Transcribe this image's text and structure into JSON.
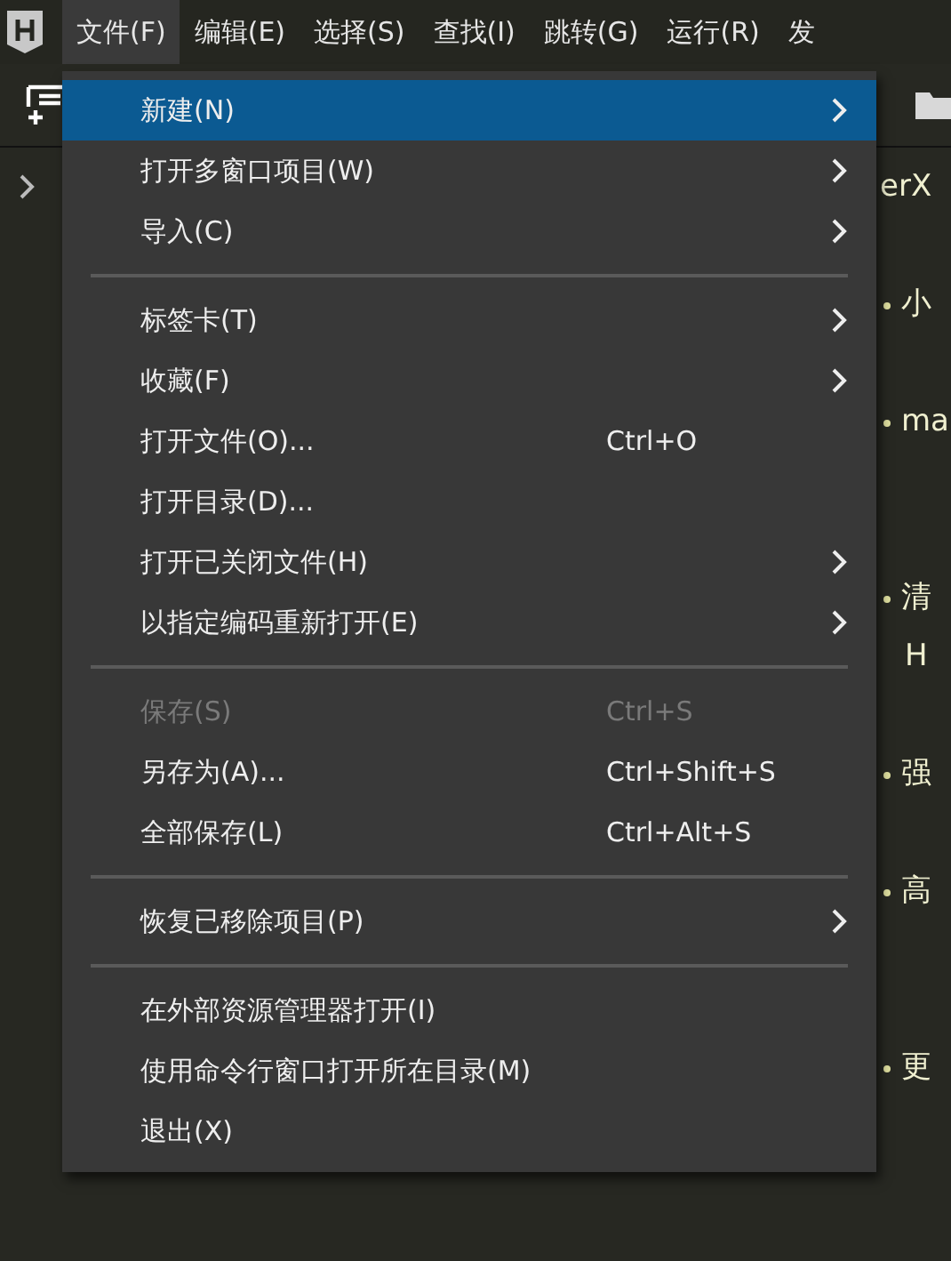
{
  "menubar": [
    {
      "label": "文件(F)",
      "selected": true
    },
    {
      "label": "编辑(E)",
      "selected": false
    },
    {
      "label": "选择(S)",
      "selected": false
    },
    {
      "label": "查找(I)",
      "selected": false
    },
    {
      "label": "跳转(G)",
      "selected": false
    },
    {
      "label": "运行(R)",
      "selected": false
    },
    {
      "label": "发",
      "selected": false
    }
  ],
  "editor": {
    "lines": [
      {
        "kind": "heading",
        "text": "erX"
      },
      {
        "kind": "blank"
      },
      {
        "kind": "bullet",
        "text": "小"
      },
      {
        "kind": "blank"
      },
      {
        "kind": "bullet",
        "text": "ma"
      },
      {
        "kind": "blank"
      },
      {
        "kind": "blank"
      },
      {
        "kind": "bullet",
        "text": "清"
      },
      {
        "kind": "continuation",
        "text": "H"
      },
      {
        "kind": "blank"
      },
      {
        "kind": "bullet",
        "text": "强"
      },
      {
        "kind": "blank"
      },
      {
        "kind": "bullet",
        "text": "高"
      },
      {
        "kind": "blank"
      },
      {
        "kind": "blank"
      },
      {
        "kind": "bullet",
        "text": "更"
      }
    ]
  },
  "menu": {
    "items": [
      {
        "kind": "item",
        "label": "新建(N)",
        "submenu": true,
        "disabled": false,
        "selected": true
      },
      {
        "kind": "item",
        "label": "打开多窗口项目(W)",
        "submenu": true,
        "disabled": false,
        "selected": false
      },
      {
        "kind": "item",
        "label": "导入(C)",
        "submenu": true,
        "disabled": false,
        "selected": false
      },
      {
        "kind": "separator"
      },
      {
        "kind": "item",
        "label": "标签卡(T)",
        "submenu": true,
        "disabled": false,
        "selected": false
      },
      {
        "kind": "item",
        "label": "收藏(F)",
        "submenu": true,
        "disabled": false,
        "selected": false
      },
      {
        "kind": "item",
        "label": "打开文件(O)...",
        "shortcut": "Ctrl+O",
        "submenu": false,
        "disabled": false,
        "selected": false
      },
      {
        "kind": "item",
        "label": "打开目录(D)...",
        "submenu": false,
        "disabled": false,
        "selected": false
      },
      {
        "kind": "item",
        "label": "打开已关闭文件(H)",
        "submenu": true,
        "disabled": false,
        "selected": false
      },
      {
        "kind": "item",
        "label": "以指定编码重新打开(E)",
        "submenu": true,
        "disabled": false,
        "selected": false
      },
      {
        "kind": "separator"
      },
      {
        "kind": "item",
        "label": "保存(S)",
        "shortcut": "Ctrl+S",
        "submenu": false,
        "disabled": true,
        "selected": false
      },
      {
        "kind": "item",
        "label": "另存为(A)...",
        "shortcut": "Ctrl+Shift+S",
        "submenu": false,
        "disabled": false,
        "selected": false
      },
      {
        "kind": "item",
        "label": "全部保存(L)",
        "shortcut": "Ctrl+Alt+S",
        "submenu": false,
        "disabled": false,
        "selected": false
      },
      {
        "kind": "separator"
      },
      {
        "kind": "item",
        "label": "恢复已移除项目(P)",
        "submenu": true,
        "disabled": false,
        "selected": false
      },
      {
        "kind": "separator"
      },
      {
        "kind": "item",
        "label": "在外部资源管理器打开(I)",
        "submenu": false,
        "disabled": false,
        "selected": false
      },
      {
        "kind": "item",
        "label": "使用命令行窗口打开所在目录(M)",
        "submenu": false,
        "disabled": false,
        "selected": false
      },
      {
        "kind": "item",
        "label": "退出(X)",
        "submenu": false,
        "disabled": false,
        "selected": false
      }
    ]
  }
}
